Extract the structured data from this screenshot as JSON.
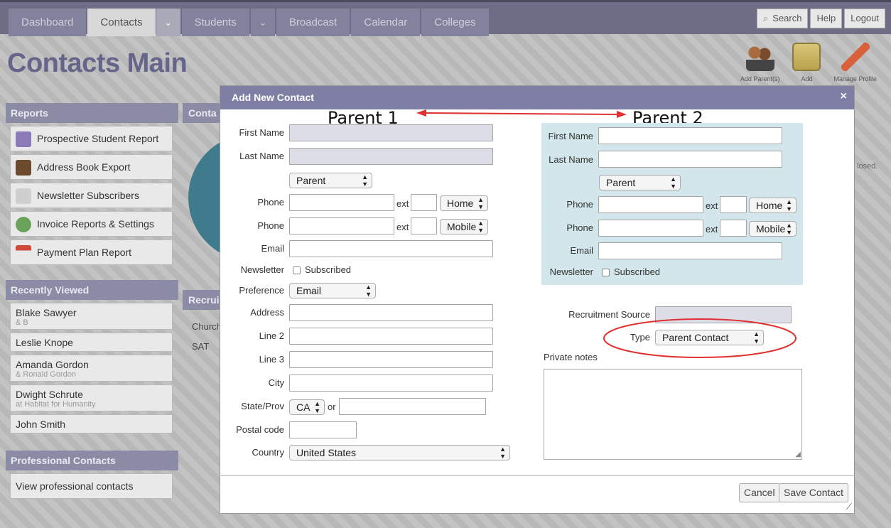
{
  "nav": {
    "tabs": [
      "Dashboard",
      "Contacts",
      "Students",
      "Broadcast",
      "Calendar",
      "Colleges"
    ],
    "search_label": "Search",
    "help_label": "Help",
    "logout_label": "Logout"
  },
  "page": {
    "title": "Contacts Main"
  },
  "actions": [
    "Add Parent(s)",
    "Add",
    "Manage Profile"
  ],
  "sidebar": {
    "reports_title": "Reports",
    "reports": [
      "Prospective Student Report",
      "Address Book Export",
      "Newsletter Subscribers",
      "Invoice Reports & Settings",
      "Payment Plan Report"
    ],
    "recent_title": "Recently Viewed",
    "recent": [
      {
        "name": "Blake Sawyer",
        "sub": "& B"
      },
      {
        "name": "Leslie Knope",
        "sub": ""
      },
      {
        "name": "Amanda Gordon",
        "sub": "& Ronald Gordon"
      },
      {
        "name": "Dwight Schrute",
        "sub": "at Habitat for Humanity"
      },
      {
        "name": "John Smith",
        "sub": ""
      }
    ],
    "pro_title": "Professional Contacts",
    "pro_link": "View professional contacts"
  },
  "background": {
    "contacts_head": "Conta",
    "recruit_head": "Recrui",
    "church": "Church",
    "sat": "SAT",
    "closed": "losed."
  },
  "modal": {
    "title": "Add New Contact",
    "close": "×",
    "annotation_parent1": "Parent 1",
    "annotation_parent2": "Parent 2",
    "labels": {
      "first_name": "First Name",
      "last_name": "Last Name",
      "phone": "Phone",
      "ext": "ext",
      "email": "Email",
      "newsletter": "Newsletter",
      "subscribed": "Subscribed",
      "preference": "Preference",
      "address": "Address",
      "line2": "Line 2",
      "line3": "Line 3",
      "city": "City",
      "state": "State/Prov",
      "or": "or",
      "postal": "Postal code",
      "country": "Country",
      "recruitment_source": "Recruitment Source",
      "type": "Type",
      "private_notes": "Private notes"
    },
    "parent1": {
      "relation": "Parent",
      "phone1_type": "Home",
      "phone2_type": "Mobile",
      "preference": "Email",
      "state": "CA",
      "country": "United States"
    },
    "parent2": {
      "relation": "Parent",
      "phone1_type": "Home",
      "phone2_type": "Mobile"
    },
    "type_value": "Parent Contact",
    "cancel": "Cancel",
    "save": "Save Contact"
  },
  "colors": {
    "nav_bg": "#6f6d85",
    "accent": "#7f7ea4",
    "annotation": "#e03030",
    "panel": "#d2e6ec"
  }
}
